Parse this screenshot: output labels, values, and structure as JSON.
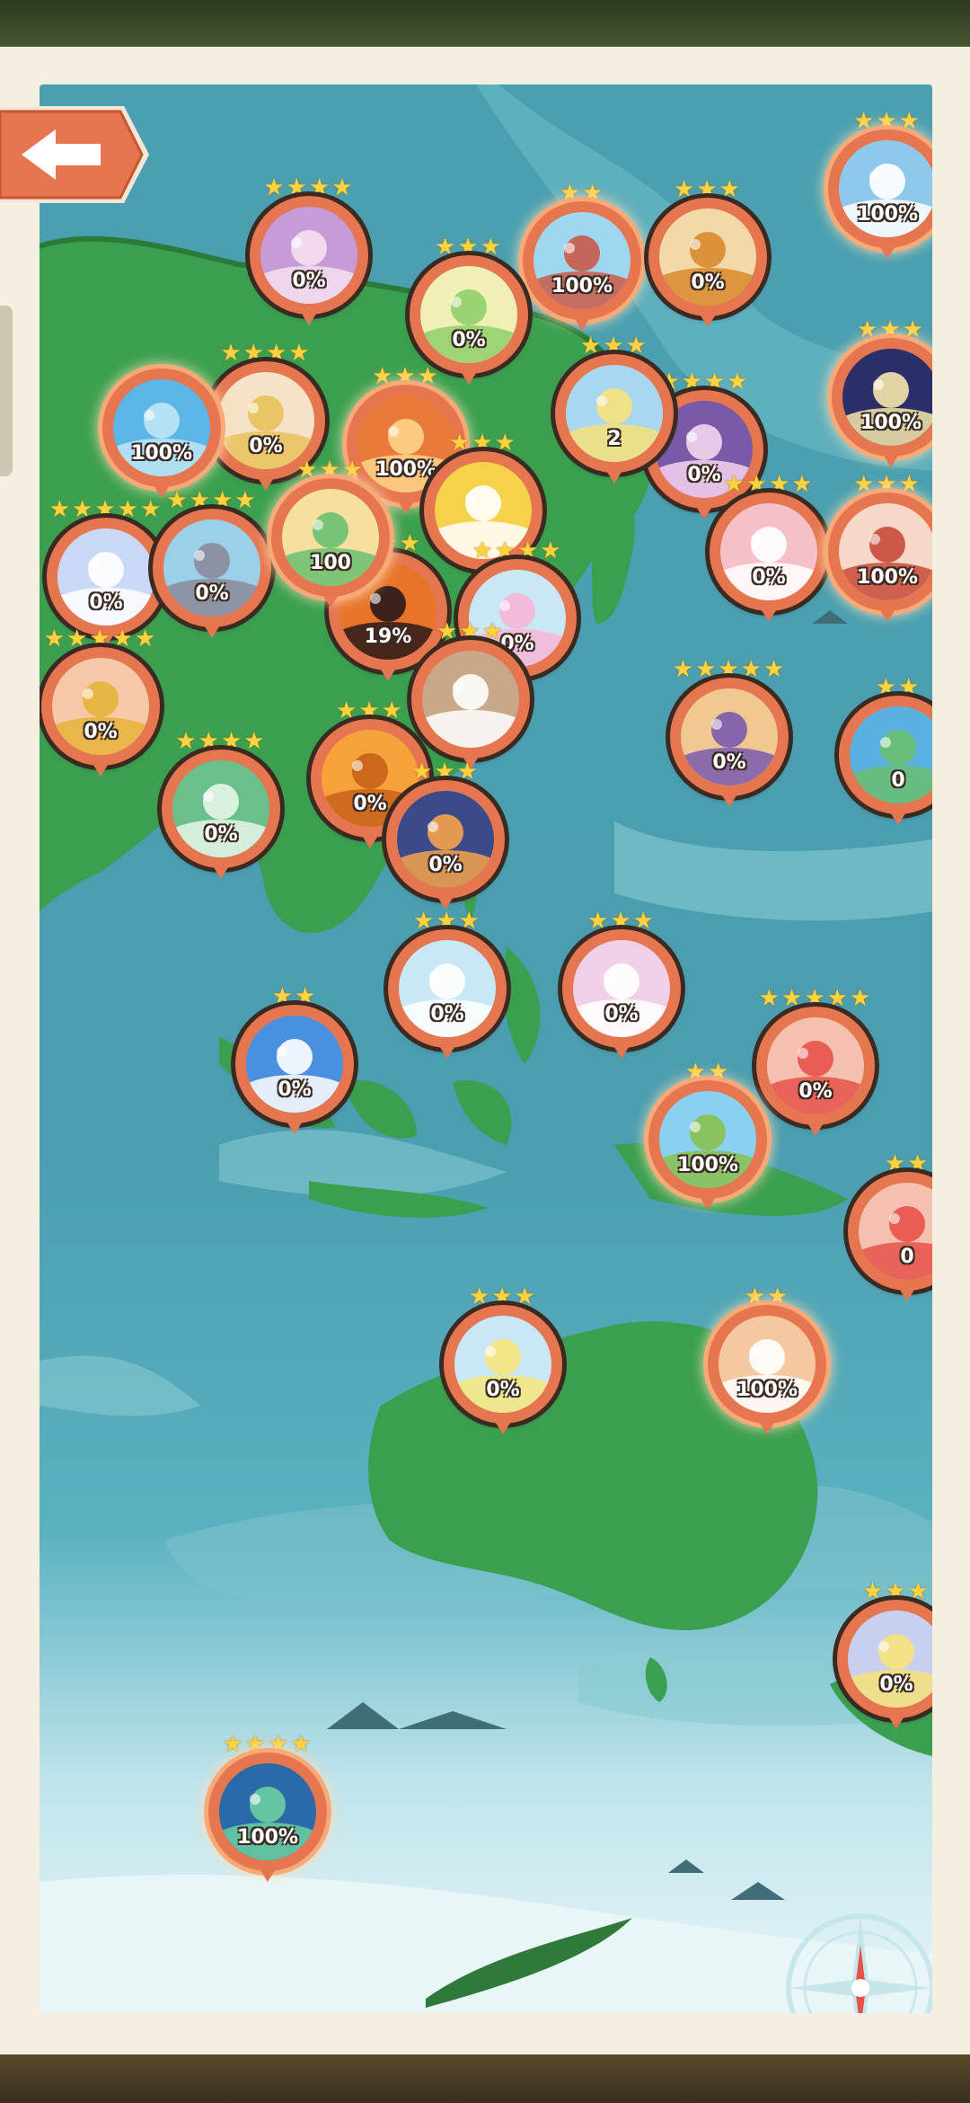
{
  "screen": {
    "name": "world-map-asia-pacific",
    "back_label": "Back"
  },
  "colors": {
    "ring": "#e5764f",
    "ring_dark": "#3a2a22",
    "star": "#ffd23f",
    "ocean": "#4aa0b0",
    "land": "#3aa050",
    "panel": "#f5efe1"
  },
  "markers": [
    {
      "id": "swans",
      "icon": "swans-icon",
      "percent": "0%",
      "stars": 4,
      "done": false,
      "c1": "#c79ad8",
      "c2": "#f6e0f0"
    },
    {
      "id": "festival-gate",
      "icon": "gate-icon",
      "percent": "100%",
      "stars": 2,
      "done": true,
      "c1": "#9fd7f0",
      "c2": "#c95a4a"
    },
    {
      "id": "autumn-leaves",
      "icon": "leaf-icon",
      "percent": "0%",
      "stars": 3,
      "done": false,
      "c1": "#f4d9a8",
      "c2": "#d8892e"
    },
    {
      "id": "ice-tree",
      "icon": "ice-icon",
      "percent": "100%",
      "stars": 3,
      "done": true,
      "c1": "#8fc8ea",
      "c2": "#ffffff"
    },
    {
      "id": "flower-wreath",
      "icon": "wreath-icon",
      "percent": "0%",
      "stars": 3,
      "done": false,
      "c1": "#f0efb6",
      "c2": "#8fcf6a"
    },
    {
      "id": "moon-night",
      "icon": "moon-icon",
      "percent": "100%",
      "stars": 3,
      "done": true,
      "c1": "#2a2f6a",
      "c2": "#f6e7a8"
    },
    {
      "id": "open-book",
      "icon": "book-icon",
      "percent": "0%",
      "stars": 4,
      "done": false,
      "c1": "#f6e2c6",
      "c2": "#e8c25a"
    },
    {
      "id": "rabbit",
      "icon": "rabbit-icon",
      "percent": "100%",
      "stars": 3,
      "done": true,
      "c1": "#e87a3a",
      "c2": "#ffd38a"
    },
    {
      "id": "raindrops",
      "icon": "raindrop-icon",
      "percent": "100%",
      "stars": 0,
      "done": true,
      "c1": "#5ab6e6",
      "c2": "#bfe6f6"
    },
    {
      "id": "purple-mask",
      "icon": "mask-icon",
      "percent": "0%",
      "stars": 4,
      "done": false,
      "c1": "#7a5aa8",
      "c2": "#f4d4f0"
    },
    {
      "id": "flower-swirl",
      "icon": "swirl-icon",
      "percent": "2",
      "stars": 3,
      "done": false,
      "c1": "#a8d8f0",
      "c2": "#f6e27a"
    },
    {
      "id": "pink-gate",
      "icon": "pink-gate-icon",
      "percent": "0%",
      "stars": 4,
      "done": false,
      "c1": "#f6c0c8",
      "c2": "#ffffff"
    },
    {
      "id": "red-ribbon",
      "icon": "ribbon-icon",
      "percent": "100%",
      "stars": 3,
      "done": true,
      "c1": "#f6d8c8",
      "c2": "#c84a3a"
    },
    {
      "id": "paper-plane-west",
      "icon": "paper-plane-icon",
      "percent": "0%",
      "stars": 5,
      "done": false,
      "c1": "#c8d8f6",
      "c2": "#ffffff"
    },
    {
      "id": "mountain-cloud",
      "icon": "mountain-icon",
      "percent": "0%",
      "stars": 4,
      "done": false,
      "c1": "#9ad0e8",
      "c2": "#8a8a9a"
    },
    {
      "id": "tiger",
      "icon": "tiger-icon",
      "percent": "19%",
      "stars": 3,
      "done": false,
      "c1": "#e8742a",
      "c2": "#2a1a1a"
    },
    {
      "id": "heart-sun",
      "icon": "heart-sun-icon",
      "percent": "",
      "stars": 3,
      "done": false,
      "c1": "#f6d24a",
      "c2": "#ffffff"
    },
    {
      "id": "tulips",
      "icon": "tulip-icon",
      "percent": "0%",
      "stars": 4,
      "done": false,
      "c1": "#c8e8f6",
      "c2": "#f6b6d8"
    },
    {
      "id": "fan",
      "icon": "fan-icon",
      "percent": "100",
      "stars": 3,
      "done": true,
      "c1": "#f6e0a0",
      "c2": "#6ac070"
    },
    {
      "id": "snake",
      "icon": "snake-icon",
      "percent": "0%",
      "stars": 5,
      "done": false,
      "c1": "#f6c8a8",
      "c2": "#e8b23a"
    },
    {
      "id": "purple-bed",
      "icon": "bed-icon",
      "percent": "0%",
      "stars": 5,
      "done": false,
      "c1": "#f0c890",
      "c2": "#7a5ab0"
    },
    {
      "id": "palm-beach",
      "icon": "palm-icon",
      "percent": "0",
      "stars": 2,
      "done": false,
      "c1": "#5ab0e0",
      "c2": "#6ac070"
    },
    {
      "id": "cotton-flower",
      "icon": "cotton-icon",
      "percent": "",
      "stars": 3,
      "done": false,
      "c1": "#c8a888",
      "c2": "#ffffff"
    },
    {
      "id": "sun-tile",
      "icon": "sun-tile-icon",
      "percent": "0%",
      "stars": 3,
      "done": false,
      "c1": "#f6a23a",
      "c2": "#c8621a"
    },
    {
      "id": "jade-vase",
      "icon": "vase-icon",
      "percent": "0%",
      "stars": 4,
      "done": false,
      "c1": "#6ac08a",
      "c2": "#e8f6e8"
    },
    {
      "id": "city-tower",
      "icon": "tower-icon",
      "percent": "0%",
      "stars": 3,
      "done": false,
      "c1": "#3a4a8a",
      "c2": "#f6a24a"
    },
    {
      "id": "magnolia",
      "icon": "magnolia-icon",
      "percent": "0%",
      "stars": 3,
      "done": false,
      "c1": "#c8e8f6",
      "c2": "#ffffff"
    },
    {
      "id": "paper-plane-east",
      "icon": "paper-plane-icon",
      "percent": "0%",
      "stars": 3,
      "done": false,
      "c1": "#f0d0e8",
      "c2": "#ffffff"
    },
    {
      "id": "hearts",
      "icon": "hearts-icon",
      "percent": "0%",
      "stars": 5,
      "done": false,
      "c1": "#f6c0b0",
      "c2": "#e8524a"
    },
    {
      "id": "merlion",
      "icon": "merlion-icon",
      "percent": "0%",
      "stars": 2,
      "done": false,
      "c1": "#4a90e0",
      "c2": "#ffffff"
    },
    {
      "id": "island-turtle",
      "icon": "island-icon",
      "percent": "100%",
      "stars": 2,
      "done": true,
      "c1": "#8ad0f0",
      "c2": "#8ac050"
    },
    {
      "id": "heart-pulse",
      "icon": "heart-pulse-icon",
      "percent": "0",
      "stars": 2,
      "done": false,
      "c1": "#f6c0b0",
      "c2": "#e8524a"
    },
    {
      "id": "yellow-lily",
      "icon": "lily-icon",
      "percent": "0%",
      "stars": 3,
      "done": false,
      "c1": "#c8e8f6",
      "c2": "#f6e67a"
    },
    {
      "id": "opera-house",
      "icon": "opera-house-icon",
      "percent": "100%",
      "stars": 2,
      "done": true,
      "c1": "#f6c8a0",
      "c2": "#ffffff"
    },
    {
      "id": "spiral-shell",
      "icon": "spiral-icon",
      "percent": "0%",
      "stars": 3,
      "done": false,
      "c1": "#c8d0f0",
      "c2": "#f6e27a"
    },
    {
      "id": "aurora-mountains",
      "icon": "aurora-icon",
      "percent": "100%",
      "stars": 4,
      "done": true,
      "c1": "#2a6aa8",
      "c2": "#6ad0a0"
    }
  ]
}
